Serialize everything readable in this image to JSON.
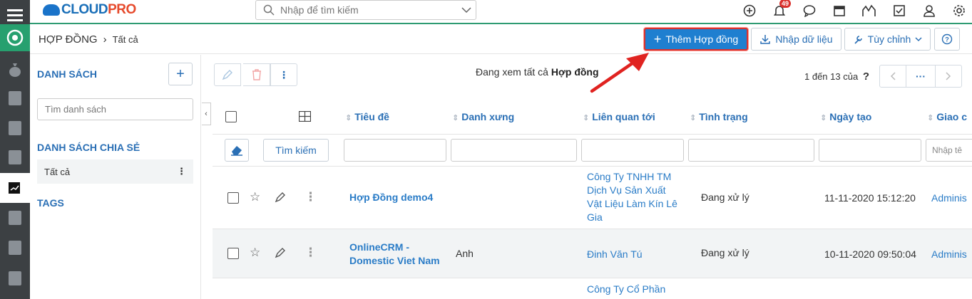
{
  "topbar": {
    "logo_main": "CLOUD",
    "logo_accent": "PRO",
    "search_placeholder": "Nhập để tìm kiếm",
    "notification_count": "49"
  },
  "header": {
    "breadcrumb_module": "HỢP ĐỒNG",
    "breadcrumb_sep": "›",
    "breadcrumb_view": "Tất cả",
    "add_button": "Thêm Hợp đồng",
    "import_button": "Nhập dữ liệu",
    "customize_button": "Tùy chỉnh"
  },
  "sidebar": {
    "list_title": "DANH SÁCH",
    "search_placeholder": "Tìm danh sách",
    "shared_title": "DANH SÁCH CHIA SẺ",
    "shared_item": "Tất cả",
    "tags_title": "TAGS"
  },
  "toolbar": {
    "viewing_prefix": "Đang xem tất cả ",
    "viewing_module": "Hợp đồng",
    "pager_text": "1 đến 13 của",
    "pager_unknown": "?",
    "pager_more": "···"
  },
  "table": {
    "columns": [
      "Tiêu đề",
      "Danh xưng",
      "Liên quan tới",
      "Tình trạng",
      "Ngày tạo",
      "Giao c"
    ],
    "search_button": "Tìm kiếm",
    "last_filter_placeholder": "Nhập tê",
    "rows": [
      {
        "title": "Hợp Đồng demo4",
        "salutation": "",
        "related": "Công Ty TNHH TM Dịch Vụ Sản Xuất Vật Liệu Làm Kín Lê Gia",
        "status": "Đang xử lý",
        "created": "11-11-2020 15:12:20",
        "assigned": "Adminis"
      },
      {
        "title": "OnlineCRM - Domestic Viet Nam",
        "salutation": "Anh",
        "related": "Đinh Văn Tú",
        "status": "Đang xử lý",
        "created": "10-11-2020 09:50:04",
        "assigned": "Adminis"
      },
      {
        "title": "",
        "salutation": "",
        "related": "Công Ty Cổ Phần",
        "status": "",
        "created": "",
        "assigned": ""
      }
    ]
  },
  "colors": {
    "accent": "#2a6fb5",
    "primary_button": "#1f7fd0",
    "highlight": "#d9312c",
    "rail": "#3c4043",
    "rail_active": "#27a06f"
  }
}
